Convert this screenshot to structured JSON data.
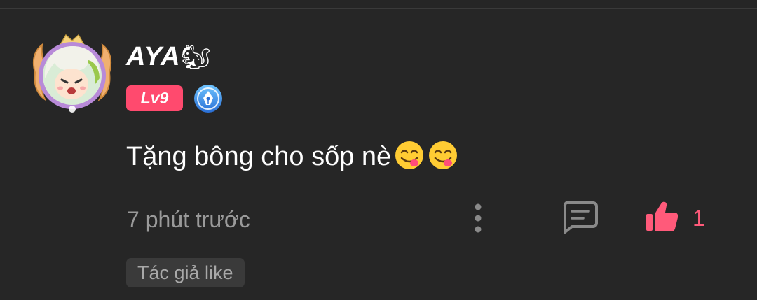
{
  "comment": {
    "username": "AYA",
    "username_emoji": "🐿",
    "level": "Lv9",
    "text": "Tặng bông cho sốp nè",
    "emojis": [
      "face-savoring-food",
      "face-savoring-food"
    ],
    "timestamp": "7 phút trước",
    "like_count": "1",
    "author_like_tag": "Tác giả like"
  },
  "icons": {
    "avatar": "avatar-with-winged-frame",
    "pen_badge": "pen-nib-icon",
    "more": "vertical-dots-icon",
    "reply": "comment-bubble-icon",
    "like": "thumbs-up-icon"
  },
  "colors": {
    "background": "#262626",
    "level_badge": "#ff4a6e",
    "like_accent": "#ff5a7a",
    "secondary_text": "#9a9a9a",
    "tag_background": "#3a3a3a"
  }
}
